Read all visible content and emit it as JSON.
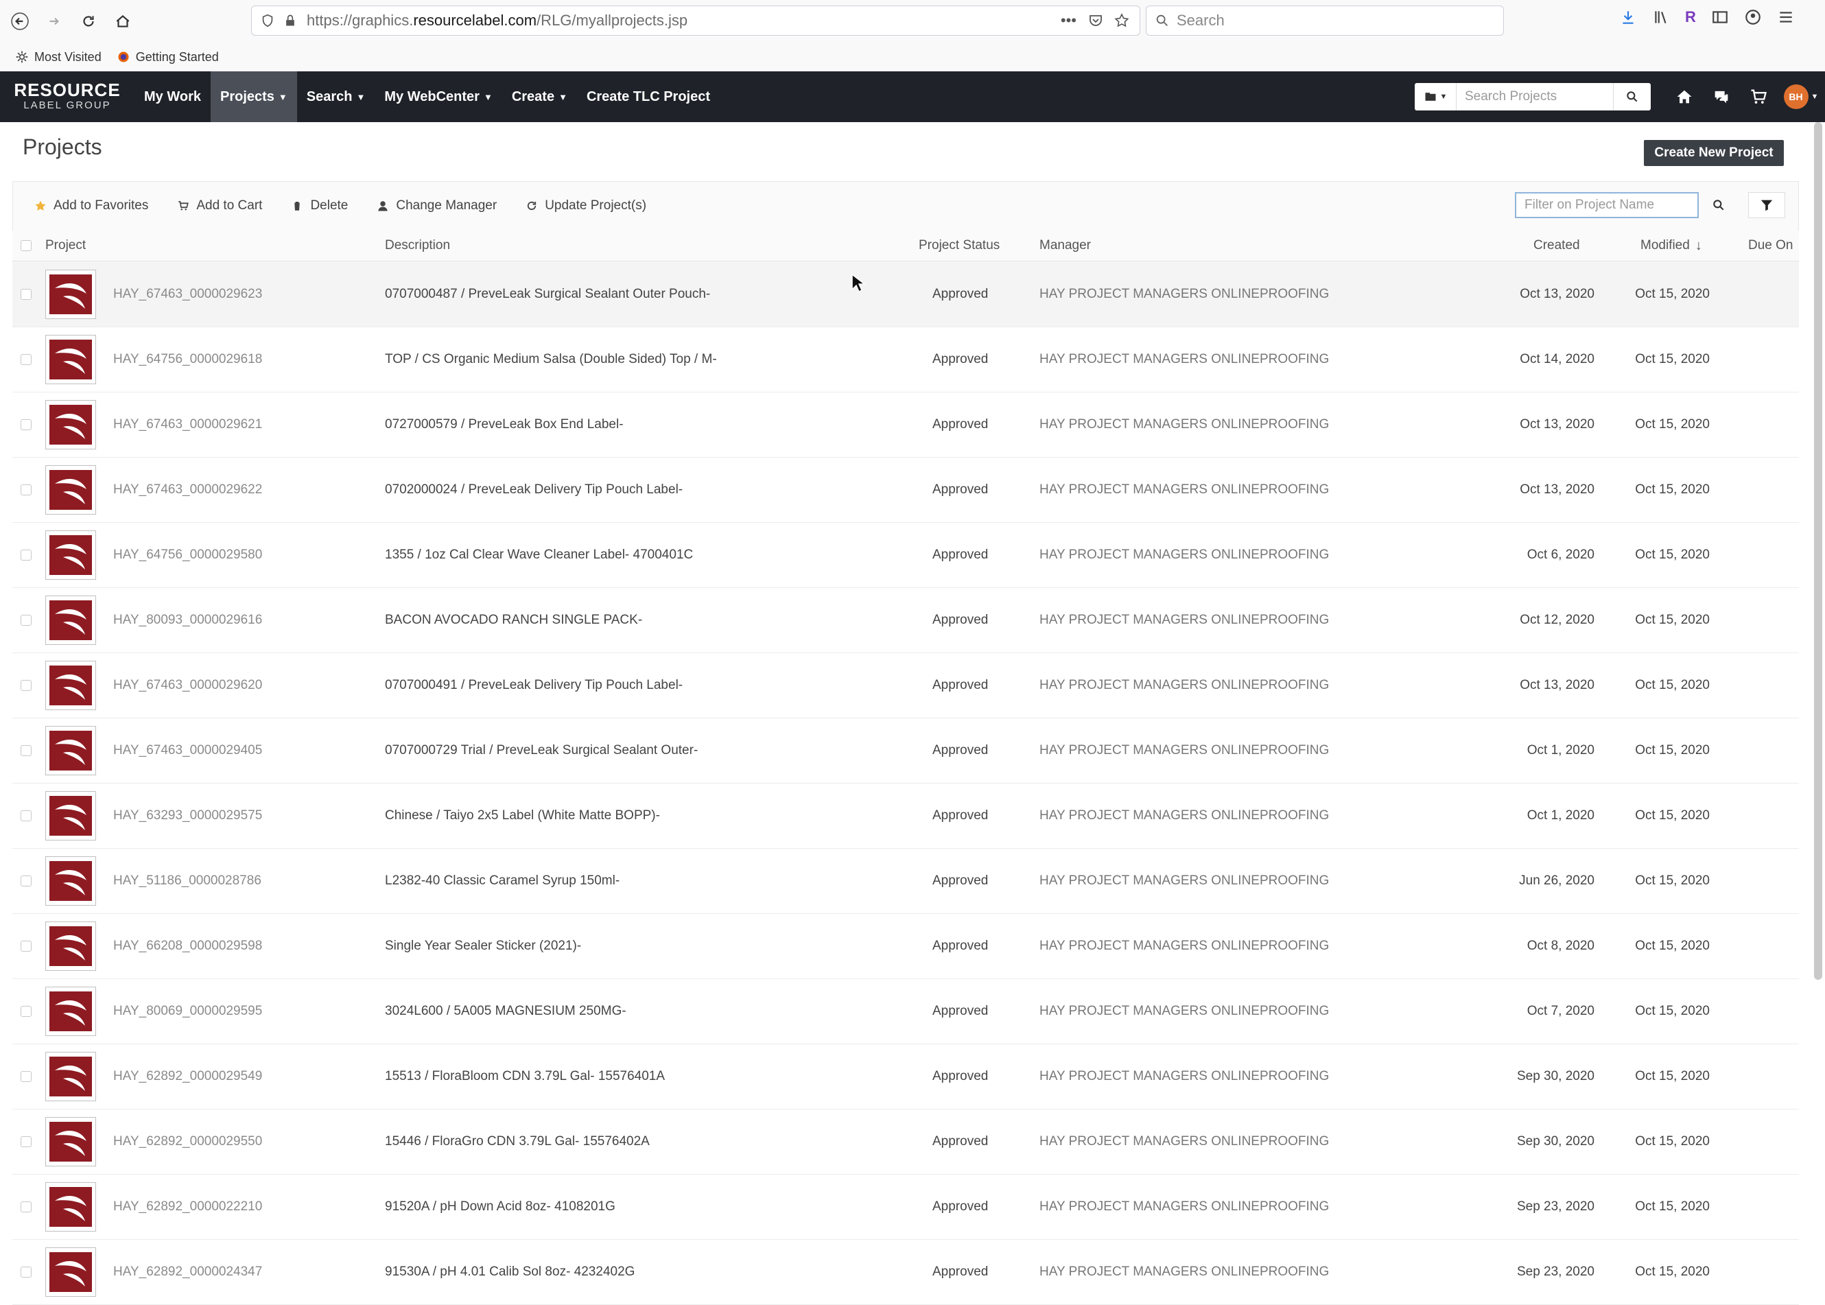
{
  "browser": {
    "url_prefix": "https://graphics.",
    "url_domain": "resourcelabel.com",
    "url_path": "/RLG/myallprojects.jsp",
    "search_placeholder": "Search",
    "bookmarks": [
      {
        "label": "Most Visited",
        "icon": "gear-icon"
      },
      {
        "label": "Getting Started",
        "icon": "firefox-icon"
      }
    ]
  },
  "app_nav": {
    "logo_line1": "RESOURCE",
    "logo_line2": "LABEL GROUP",
    "items": [
      "My Work",
      "Projects",
      "Search",
      "My WebCenter",
      "Create",
      "Create TLC Project"
    ],
    "search_placeholder": "Search Projects",
    "avatar_initials": "BH",
    "accent": "#e0702e"
  },
  "page": {
    "title": "Projects",
    "create_button": "Create New Project"
  },
  "toolbar": {
    "add_to_favorites": "Add to Favorites",
    "add_to_cart": "Add to Cart",
    "delete": "Delete",
    "change_manager": "Change Manager",
    "update_projects": "Update Project(s)",
    "filter_placeholder": "Filter on Project Name"
  },
  "table": {
    "columns": {
      "project": "Project",
      "description": "Description",
      "status": "Project Status",
      "manager": "Manager",
      "created": "Created",
      "modified": "Modified",
      "due_on": "Due On"
    },
    "sorted_by": "Modified",
    "rows": [
      {
        "project": "HAY_67463_0000029623",
        "description": "0707000487 / PreveLeak Surgical Sealant Outer Pouch-",
        "status": "Approved",
        "manager": "HAY PROJECT MANAGERS ONLINEPROOFING",
        "created": "Oct 13, 2020",
        "modified": "Oct 15, 2020"
      },
      {
        "project": "HAY_64756_0000029618",
        "description": "TOP / CS Organic Medium Salsa (Double Sided) Top / M-",
        "status": "Approved",
        "manager": "HAY PROJECT MANAGERS ONLINEPROOFING",
        "created": "Oct 14, 2020",
        "modified": "Oct 15, 2020"
      },
      {
        "project": "HAY_67463_0000029621",
        "description": "0727000579 / PreveLeak Box End Label-",
        "status": "Approved",
        "manager": "HAY PROJECT MANAGERS ONLINEPROOFING",
        "created": "Oct 13, 2020",
        "modified": "Oct 15, 2020"
      },
      {
        "project": "HAY_67463_0000029622",
        "description": "0702000024 / PreveLeak Delivery Tip Pouch Label-",
        "status": "Approved",
        "manager": "HAY PROJECT MANAGERS ONLINEPROOFING",
        "created": "Oct 13, 2020",
        "modified": "Oct 15, 2020"
      },
      {
        "project": "HAY_64756_0000029580",
        "description": "1355 / 1oz Cal Clear Wave Cleaner Label- 4700401C",
        "status": "Approved",
        "manager": "HAY PROJECT MANAGERS ONLINEPROOFING",
        "created": "Oct 6, 2020",
        "modified": "Oct 15, 2020"
      },
      {
        "project": "HAY_80093_0000029616",
        "description": "BACON AVOCADO RANCH SINGLE PACK-",
        "status": "Approved",
        "manager": "HAY PROJECT MANAGERS ONLINEPROOFING",
        "created": "Oct 12, 2020",
        "modified": "Oct 15, 2020"
      },
      {
        "project": "HAY_67463_0000029620",
        "description": "0707000491 / PreveLeak Delivery Tip Pouch Label-",
        "status": "Approved",
        "manager": "HAY PROJECT MANAGERS ONLINEPROOFING",
        "created": "Oct 13, 2020",
        "modified": "Oct 15, 2020"
      },
      {
        "project": "HAY_67463_0000029405",
        "description": "0707000729 Trial / PreveLeak Surgical Sealant Outer-",
        "status": "Approved",
        "manager": "HAY PROJECT MANAGERS ONLINEPROOFING",
        "created": "Oct 1, 2020",
        "modified": "Oct 15, 2020"
      },
      {
        "project": "HAY_63293_0000029575",
        "description": "Chinese / Taiyo 2x5 Label (White Matte BOPP)-",
        "status": "Approved",
        "manager": "HAY PROJECT MANAGERS ONLINEPROOFING",
        "created": "Oct 1, 2020",
        "modified": "Oct 15, 2020"
      },
      {
        "project": "HAY_51186_0000028786",
        "description": "L2382-40 Classic Caramel Syrup 150ml-",
        "status": "Approved",
        "manager": "HAY PROJECT MANAGERS ONLINEPROOFING",
        "created": "Jun 26, 2020",
        "modified": "Oct 15, 2020"
      },
      {
        "project": "HAY_66208_0000029598",
        "description": "Single Year Sealer Sticker (2021)-",
        "status": "Approved",
        "manager": "HAY PROJECT MANAGERS ONLINEPROOFING",
        "created": "Oct 8, 2020",
        "modified": "Oct 15, 2020"
      },
      {
        "project": "HAY_80069_0000029595",
        "description": "3024L600 / 5A005 MAGNESIUM 250MG-",
        "status": "Approved",
        "manager": "HAY PROJECT MANAGERS ONLINEPROOFING",
        "created": "Oct 7, 2020",
        "modified": "Oct 15, 2020"
      },
      {
        "project": "HAY_62892_0000029549",
        "description": "15513 / FloraBloom CDN 3.79L Gal- 15576401A",
        "status": "Approved",
        "manager": "HAY PROJECT MANAGERS ONLINEPROOFING",
        "created": "Sep 30, 2020",
        "modified": "Oct 15, 2020"
      },
      {
        "project": "HAY_62892_0000029550",
        "description": "15446 / FloraGro CDN 3.79L Gal- 15576402A",
        "status": "Approved",
        "manager": "HAY PROJECT MANAGERS ONLINEPROOFING",
        "created": "Sep 30, 2020",
        "modified": "Oct 15, 2020"
      },
      {
        "project": "HAY_62892_0000022210",
        "description": "91520A / pH Down Acid 8oz- 4108201G",
        "status": "Approved",
        "manager": "HAY PROJECT MANAGERS ONLINEPROOFING",
        "created": "Sep 23, 2020",
        "modified": "Oct 15, 2020"
      },
      {
        "project": "HAY_62892_0000024347",
        "description": "91530A / pH 4.01 Calib Sol 8oz- 4232402G",
        "status": "Approved",
        "manager": "HAY PROJECT MANAGERS ONLINEPROOFING",
        "created": "Sep 23, 2020",
        "modified": "Oct 15, 2020"
      }
    ]
  }
}
